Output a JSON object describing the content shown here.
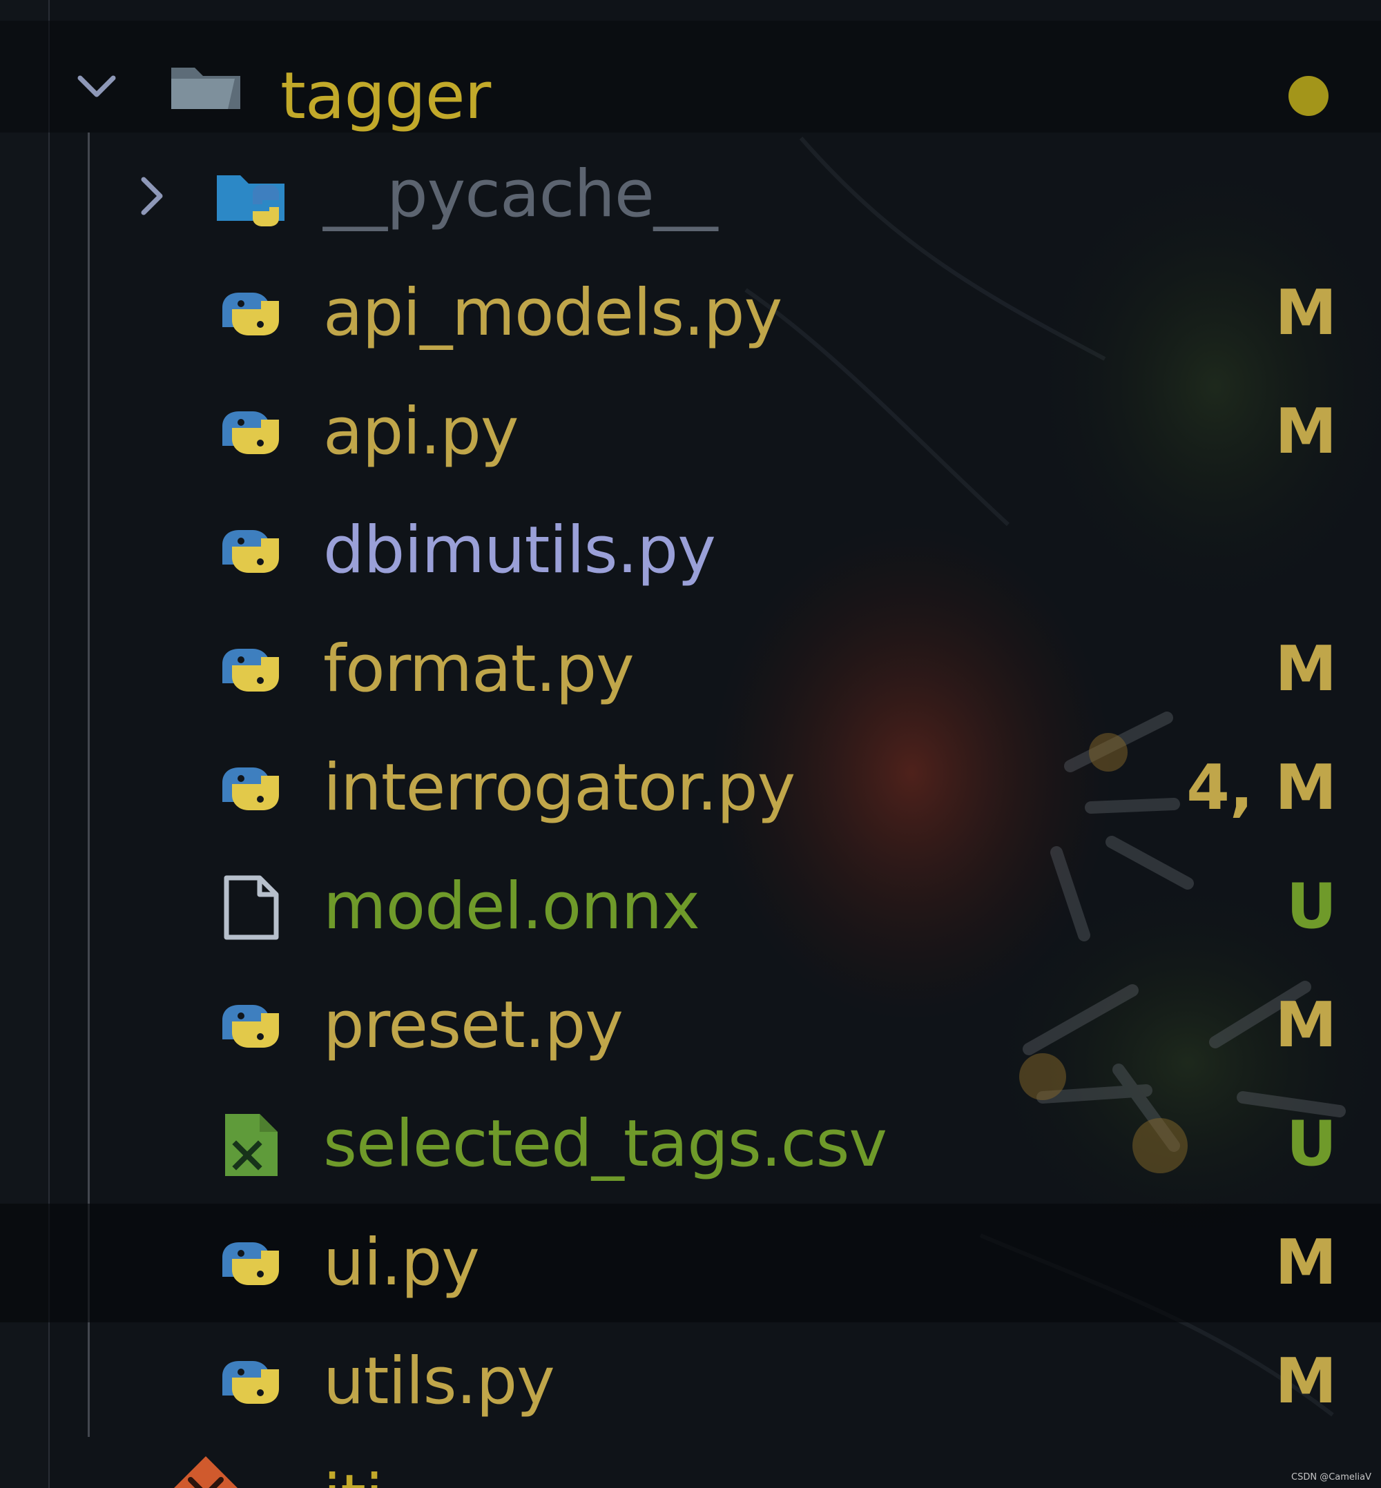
{
  "colors": {
    "modified": "#c0a64a",
    "untracked": "#6f9a2a",
    "conflicted": "#9aa0d8",
    "folder_text": "#c2a92a",
    "ignored": "#5c6470",
    "modified_dot": "#a3951a",
    "chevron": "#8e98b8"
  },
  "explorer": {
    "root": {
      "name": "tagger",
      "icon": "folder-open-icon",
      "expanded": true
    },
    "items": [
      {
        "name": "__pycache__",
        "icon": "python-folder-icon",
        "kind": "folder",
        "status": "",
        "tone": "ignored"
      },
      {
        "name": "api_models.py",
        "icon": "python-icon",
        "kind": "file",
        "status": "M",
        "tone": "modified"
      },
      {
        "name": "api.py",
        "icon": "python-icon",
        "kind": "file",
        "status": "M",
        "tone": "modified"
      },
      {
        "name": "dbimutils.py",
        "icon": "python-icon",
        "kind": "file",
        "status": "",
        "tone": "conflicted"
      },
      {
        "name": "format.py",
        "icon": "python-icon",
        "kind": "file",
        "status": "M",
        "tone": "modified"
      },
      {
        "name": "interrogator.py",
        "icon": "python-icon",
        "kind": "file",
        "status": "4, M",
        "tone": "modified"
      },
      {
        "name": "model.onnx",
        "icon": "file-icon",
        "kind": "file",
        "status": "U",
        "tone": "untracked"
      },
      {
        "name": "preset.py",
        "icon": "python-icon",
        "kind": "file",
        "status": "M",
        "tone": "modified"
      },
      {
        "name": "selected_tags.csv",
        "icon": "csv-icon",
        "kind": "file",
        "status": "U",
        "tone": "untracked"
      },
      {
        "name": "ui.py",
        "icon": "python-icon",
        "kind": "file",
        "status": "M",
        "tone": "modified",
        "selected": true
      },
      {
        "name": "utils.py",
        "icon": "python-icon",
        "kind": "file",
        "status": "M",
        "tone": "modified"
      }
    ],
    "next_row_partial": {
      "name": "iti",
      "icon": "git-icon"
    }
  },
  "watermark": "CSDN @CameliaV"
}
